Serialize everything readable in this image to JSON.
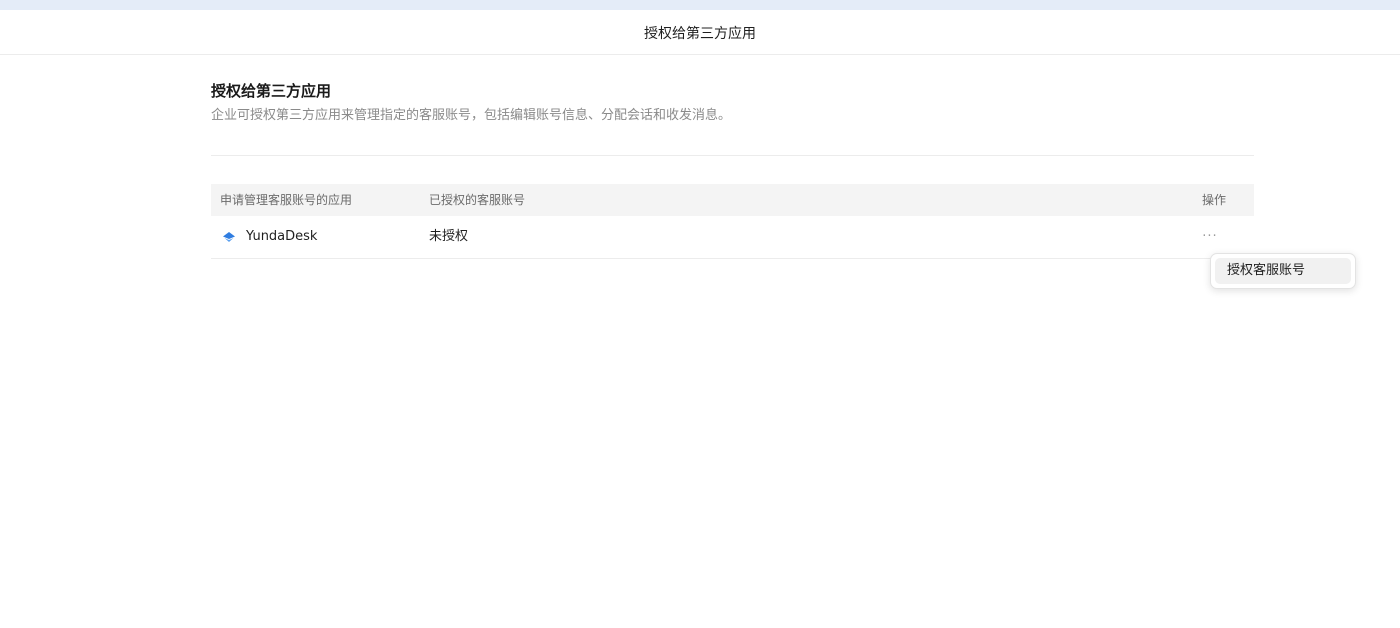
{
  "window": {
    "title": "授权给第三方应用"
  },
  "section": {
    "heading": "授权给第三方应用",
    "description": "企业可授权第三方应用来管理指定的客服账号，包括编辑账号信息、分配会话和收发消息。"
  },
  "table": {
    "headers": [
      "申请管理客服账号的应用",
      "已授权的客服账号",
      "操作"
    ],
    "rows": [
      {
        "app_icon": "yundadesk-logo-icon",
        "app_name": "YundaDesk",
        "authorized_account": "未授权",
        "action_icon": "more-icon",
        "action_label": "···"
      }
    ]
  },
  "dropdown_menu": {
    "items": [
      "授权客服账号"
    ]
  },
  "colors": {
    "top_strip": "#e4ecf8",
    "header_bg": "#f4f4f4",
    "menu_item_hover": "#f1f1f1",
    "logo_blue": "#2f7de1"
  }
}
